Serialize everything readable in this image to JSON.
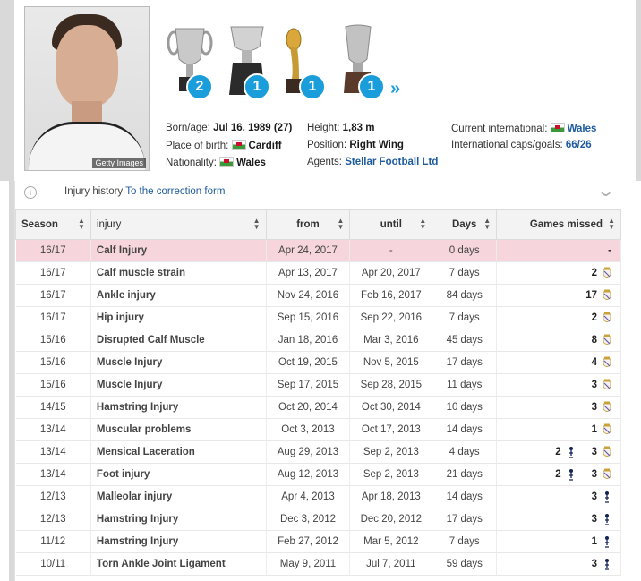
{
  "photo": {
    "credit": "Getty Images"
  },
  "trophies": [
    {
      "name": "champions-league-trophy-icon",
      "count": "2"
    },
    {
      "name": "copa-del-rey-trophy-icon",
      "count": "1"
    },
    {
      "name": "club-world-cup-trophy-icon",
      "count": "1"
    },
    {
      "name": "uefa-supercup-trophy-icon",
      "count": "1"
    }
  ],
  "more_label": "»",
  "profile": {
    "born_label": "Born/age:",
    "born_value": "Jul 16, 1989 (27)",
    "birthplace_label": "Place of birth:",
    "birthplace_value": "Cardiff",
    "nationality_label": "Nationality:",
    "nationality_value": "Wales",
    "height_label": "Height:",
    "height_value": "1,83 m",
    "position_label": "Position:",
    "position_value": "Right Wing",
    "agents_label": "Agents:",
    "agents_value": "Stellar Football Ltd",
    "intl_label": "Current international:",
    "intl_value": "Wales",
    "caps_label": "International caps/goals:",
    "caps_value": "66/26"
  },
  "panel": {
    "info_icon": "i",
    "title": "Injury history",
    "link": "To the correction form",
    "chevron": "⌄"
  },
  "table": {
    "headers": [
      "Season",
      "injury",
      "from",
      "until",
      "Days",
      "Games missed"
    ],
    "rows": [
      {
        "season": "16/17",
        "injury": "Calf Injury",
        "from": "Apr 24, 2017",
        "until": "-",
        "days": "0 days",
        "g1": "-",
        "c1": "",
        "g2": "",
        "c2": ""
      },
      {
        "season": "16/17",
        "injury": "Calf muscle strain",
        "from": "Apr 13, 2017",
        "until": "Apr 20, 2017",
        "days": "7 days",
        "g1": "2",
        "c1": "real",
        "g2": "",
        "c2": ""
      },
      {
        "season": "16/17",
        "injury": "Ankle injury",
        "from": "Nov 24, 2016",
        "until": "Feb 16, 2017",
        "days": "84 days",
        "g1": "17",
        "c1": "real",
        "g2": "",
        "c2": ""
      },
      {
        "season": "16/17",
        "injury": "Hip injury",
        "from": "Sep 15, 2016",
        "until": "Sep 22, 2016",
        "days": "7 days",
        "g1": "2",
        "c1": "real",
        "g2": "",
        "c2": ""
      },
      {
        "season": "15/16",
        "injury": "Disrupted Calf Muscle",
        "from": "Jan 18, 2016",
        "until": "Mar 3, 2016",
        "days": "45 days",
        "g1": "8",
        "c1": "real",
        "g2": "",
        "c2": ""
      },
      {
        "season": "15/16",
        "injury": "Muscle Injury",
        "from": "Oct 19, 2015",
        "until": "Nov 5, 2015",
        "days": "17 days",
        "g1": "4",
        "c1": "real",
        "g2": "",
        "c2": ""
      },
      {
        "season": "15/16",
        "injury": "Muscle Injury",
        "from": "Sep 17, 2015",
        "until": "Sep 28, 2015",
        "days": "11 days",
        "g1": "3",
        "c1": "real",
        "g2": "",
        "c2": ""
      },
      {
        "season": "14/15",
        "injury": "Hamstring Injury",
        "from": "Oct 20, 2014",
        "until": "Oct 30, 2014",
        "days": "10 days",
        "g1": "3",
        "c1": "real",
        "g2": "",
        "c2": ""
      },
      {
        "season": "13/14",
        "injury": "Muscular problems",
        "from": "Oct 3, 2013",
        "until": "Oct 17, 2013",
        "days": "14 days",
        "g1": "1",
        "c1": "real",
        "g2": "",
        "c2": ""
      },
      {
        "season": "13/14",
        "injury": "Mensical Laceration",
        "from": "Aug 29, 2013",
        "until": "Sep 2, 2013",
        "days": "4 days",
        "g1": "2",
        "c1": "spurs",
        "g2": "3",
        "c2": "real"
      },
      {
        "season": "13/14",
        "injury": "Foot injury",
        "from": "Aug 12, 2013",
        "until": "Sep 2, 2013",
        "days": "21 days",
        "g1": "2",
        "c1": "spurs",
        "g2": "3",
        "c2": "real"
      },
      {
        "season": "12/13",
        "injury": "Malleolar injury",
        "from": "Apr 4, 2013",
        "until": "Apr 18, 2013",
        "days": "14 days",
        "g1": "3",
        "c1": "spurs",
        "g2": "",
        "c2": ""
      },
      {
        "season": "12/13",
        "injury": "Hamstring Injury",
        "from": "Dec 3, 2012",
        "until": "Dec 20, 2012",
        "days": "17 days",
        "g1": "3",
        "c1": "spurs",
        "g2": "",
        "c2": ""
      },
      {
        "season": "11/12",
        "injury": "Hamstring Injury",
        "from": "Feb 27, 2012",
        "until": "Mar 5, 2012",
        "days": "7 days",
        "g1": "1",
        "c1": "spurs",
        "g2": "",
        "c2": ""
      },
      {
        "season": "10/11",
        "injury": "Torn Ankle Joint Ligament",
        "from": "May 9, 2011",
        "until": "Jul 7, 2011",
        "days": "59 days",
        "g1": "3",
        "c1": "spurs",
        "g2": "",
        "c2": ""
      }
    ]
  },
  "colors": {
    "accent": "#1a9ddb",
    "link": "#1d5b9c",
    "highlight_row": "#f6d6dc",
    "header_bg": "#f3f3f3"
  }
}
